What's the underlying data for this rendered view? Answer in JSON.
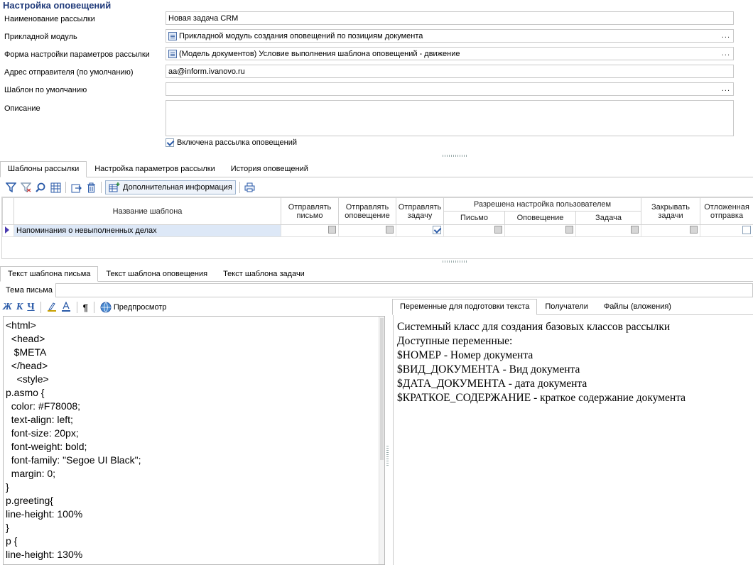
{
  "page_title": "Настройка оповещений",
  "form": {
    "name_label": "Наименование рассылки",
    "name_value": "Новая задача CRM",
    "module_label": "Прикладной модуль",
    "module_value": "Прикладной модуль создания оповещений по позициям документа",
    "form_label": "Форма настройки параметров рассылки",
    "form_value": "(Модель документов) Условие выполнения шаблона оповещений - движение",
    "sender_label": "Адрес отправителя (по умолчанию)",
    "sender_value": "aa@inform.ivanovo.ru",
    "template_label": "Шаблон по умолчанию",
    "template_value": "",
    "desc_label": "Описание",
    "desc_value": "",
    "enabled_label": "Включена рассылка оповещений",
    "enabled": true,
    "dots": "..."
  },
  "tabs": [
    "Шаблоны рассылки",
    "Настройка параметров рассылки",
    "История оповещений"
  ],
  "toolbar": {
    "icons": [
      "filter-icon",
      "filter-clear-icon",
      "search-icon",
      "columns-icon",
      "export-icon",
      "delete-icon"
    ],
    "extra_info_label": "Дополнительная информация",
    "print_icon": "printer-icon"
  },
  "grid": {
    "headers": {
      "name": "Название шаблона",
      "send_letter": "Отправлять письмо",
      "send_notice": "Отправлять оповещение",
      "send_task": "Отправлять задачу",
      "user_group": "Разрешена настройка пользователем",
      "letter": "Письмо",
      "notice": "Оповещение",
      "task": "Задача",
      "close_tasks": "Закрывать задачи",
      "deferred": "Отложенная отправка"
    },
    "rows": [
      {
        "name": "Напоминания о невыполненных делах",
        "send_letter": false,
        "send_notice": false,
        "send_task": true,
        "user_letter": false,
        "user_notice": false,
        "user_task": false,
        "close_tasks": false,
        "deferred": false
      }
    ]
  },
  "text_tabs": [
    "Текст шаблона письма",
    "Текст шаблона оповещения",
    "Текст шаблона задачи"
  ],
  "subject_label": "Тема письма",
  "subject_value": "",
  "editor_toolbar": {
    "bold": "Ж",
    "italic": "К",
    "underline": "Ч",
    "pilcrow": "¶",
    "preview_label": "Предпросмотр"
  },
  "code_lines": [
    "<html>",
    "  <head>",
    "   $META",
    "  </head>",
    "    <style>",
    "p.asmo {",
    "  color: #F78008;",
    "  text-align: left;",
    "  font-size: 20px;",
    "  font-weight: bold;",
    "  font-family: \"Segoe UI Black\";",
    "  margin: 0;",
    "}",
    "p.greeting{",
    "line-height: 100%",
    "}",
    "p {",
    "line-height: 130%"
  ],
  "right_tabs": [
    "Переменные для подготовки текста",
    "Получатели",
    "Файлы (вложения)"
  ],
  "variables_text": [
    "Системный класс для создания базовых классов рассылки",
    "Доступные переменные:",
    "$НОМЕР - Номер документа",
    "$ВИД_ДОКУМЕНТА - Вид документа",
    "$ДАТА_ДОКУМЕНТА - дата документа",
    "$КРАТКОЕ_СОДЕРЖАНИЕ - краткое содержание документа"
  ],
  "colors": {
    "title": "#1f3a7a",
    "selected_row": "#dde8f7",
    "accent": "#2a5aa8"
  }
}
